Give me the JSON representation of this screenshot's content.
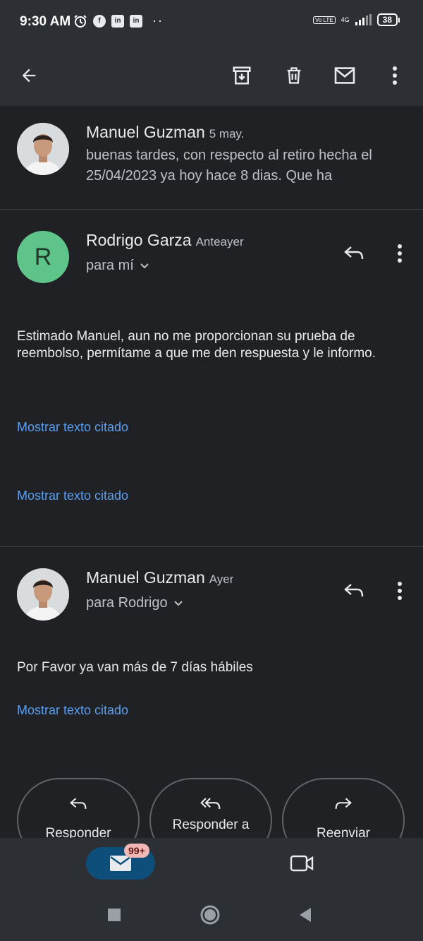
{
  "status_bar": {
    "time": "9:30 AM",
    "volte": "Vo LTE",
    "network": "4G",
    "battery": "38",
    "notification_icons": [
      "alarm-icon",
      "facebook-icon",
      "linkedin-icon",
      "linkedin-icon"
    ]
  },
  "toolbar": {
    "icons": [
      "back-arrow-icon",
      "archive-icon",
      "delete-icon",
      "mark-unread-icon",
      "more-vert-icon"
    ]
  },
  "thread": {
    "collapsed_message": {
      "sender": "Manuel Guzman",
      "date": "5 may.",
      "snippet": "buenas tardes, con respecto al retiro hecha el 25/04/2023 ya hoy hace 8 dias. Que ha"
    },
    "message_rodrigo": {
      "avatar_letter": "R",
      "sender": "Rodrigo Garza",
      "date": "Anteayer",
      "recipient": "para mí",
      "body": "Estimado Manuel, aun no me proporcionan su prueba de reembolso, permítame a que me den respuesta y le informo.",
      "show_quoted_1": "Mostrar texto citado",
      "show_quoted_2": "Mostrar texto citado"
    },
    "message_manuel": {
      "sender": "Manuel Guzman",
      "date": "Ayer",
      "recipient": "para Rodrigo",
      "body": "Por Favor ya van más de 7 días hábiles",
      "show_quoted": "Mostrar texto citado"
    }
  },
  "actions": {
    "reply": "Responder",
    "reply_all": "Responder a",
    "forward": "Reenviar"
  },
  "bottom_nav": {
    "mail_badge": "99+"
  },
  "colors": {
    "background": "#202124",
    "bar": "#2c2f33",
    "link": "#5b9ef0",
    "avatar_r": "#5ec48a",
    "mail_pill": "#0d4f7a",
    "badge": "#f2b8b5"
  }
}
